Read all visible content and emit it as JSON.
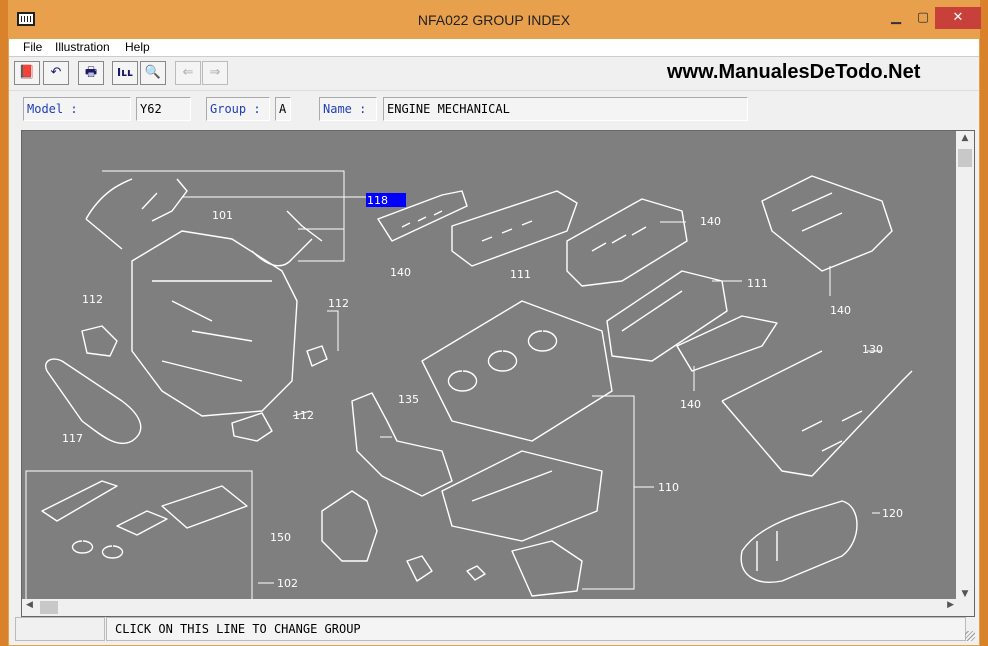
{
  "window": {
    "title": "NFA022 GROUP INDEX"
  },
  "menu": [
    "File",
    "Illustration",
    "Help"
  ],
  "toolbar": {
    "buttons": [
      {
        "name": "book-icon",
        "glyph": "📕"
      },
      {
        "name": "undo-icon",
        "glyph": "↶"
      },
      {
        "name": "print-icon",
        "glyph": "🖶"
      },
      {
        "name": "list-icon",
        "glyph": "Iʟʟ"
      },
      {
        "name": "zoom-icon",
        "glyph": "🔍"
      },
      {
        "name": "prev-group-icon",
        "glyph": "⇐"
      },
      {
        "name": "next-group-icon",
        "glyph": "⇒"
      }
    ]
  },
  "watermark": "www.ManualesDeTodo.Net",
  "info": {
    "model_label": "Model :",
    "model_value": "Y62",
    "group_label": "Group :",
    "group_value": "A",
    "name_label": "Name :",
    "name_value": "ENGINE MECHANICAL"
  },
  "diagram": {
    "callouts": [
      "118",
      "101",
      "140",
      "111",
      "140",
      "140",
      "111",
      "112",
      "112",
      "112",
      "117",
      "135",
      "140",
      "130",
      "110",
      "150",
      "120",
      "102"
    ],
    "selected": "118"
  },
  "status": {
    "hint": "CLICK ON THIS LINE TO CHANGE GROUP"
  }
}
